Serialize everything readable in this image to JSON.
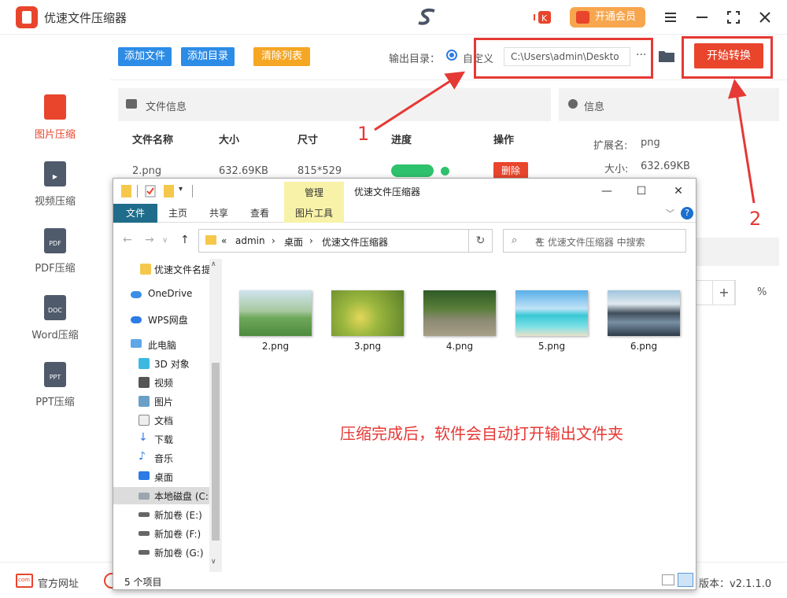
{
  "app": {
    "title": "优速文件压缩器",
    "vip_label": "开通会员",
    "version": "版本：v2.1.1.0",
    "site_link": "官方网址"
  },
  "sidebar": {
    "items": [
      {
        "label": "图片压缩",
        "icon": "image-file-icon",
        "active": true
      },
      {
        "label": "视频压缩",
        "icon": "video-file-icon",
        "active": false
      },
      {
        "label": "PDF压缩",
        "icon": "pdf-file-icon",
        "badge": "PDF",
        "active": false
      },
      {
        "label": "Word压缩",
        "icon": "doc-file-icon",
        "badge": "DOC",
        "active": false
      },
      {
        "label": "PPT压缩",
        "icon": "ppt-file-icon",
        "badge": "PPT",
        "active": false
      }
    ]
  },
  "toolbar": {
    "add_file": "添加文件",
    "add_dir": "添加目录",
    "clear_list": "清除列表",
    "output_label": "输出目录：",
    "radio_label": "自定义",
    "output_path": "C:\\Users\\admin\\Deskto",
    "more": "···",
    "start": "开始转换"
  },
  "file_panel": {
    "title": "文件信息",
    "columns": [
      "文件名称",
      "大小",
      "尺寸",
      "进度",
      "操作"
    ],
    "rows": [
      {
        "name": "2.png",
        "size": "632.69KB",
        "dims": "815*529",
        "progress": 1.0,
        "action": "删除"
      }
    ]
  },
  "info_panel": {
    "title": "信息",
    "ext_label": "扩展名:",
    "ext_value": "png",
    "size_label": "大小:",
    "size_value": "632.69KB",
    "plus": "+",
    "percent": "%"
  },
  "annotations": {
    "num1": "1",
    "num2": "2",
    "color": "#e53935"
  },
  "explorer": {
    "title": "优速文件压缩器",
    "manage_tab": "管理",
    "tabs": [
      "文件",
      "主页",
      "共享",
      "查看",
      "图片工具"
    ],
    "breadcrumb": [
      "«",
      "admin",
      "›",
      "桌面",
      "›",
      "优速文件压缩器"
    ],
    "search_placeholder": "在 优速文件压缩器 中搜索",
    "tree": [
      {
        "label": "优速文件名提",
        "icon": "folder-icon"
      },
      {
        "label": "OneDrive",
        "icon": "cloud-icon"
      },
      {
        "label": "WPS网盘",
        "icon": "wps-cloud-icon"
      },
      {
        "label": "此电脑",
        "icon": "computer-icon"
      },
      {
        "label": "3D 对象",
        "icon": "3d-objects-icon"
      },
      {
        "label": "视频",
        "icon": "video-folder-icon"
      },
      {
        "label": "图片",
        "icon": "pictures-folder-icon"
      },
      {
        "label": "文档",
        "icon": "documents-folder-icon"
      },
      {
        "label": "下载",
        "icon": "download-folder-icon"
      },
      {
        "label": "音乐",
        "icon": "music-folder-icon"
      },
      {
        "label": "桌面",
        "icon": "desktop-folder-icon"
      },
      {
        "label": "本地磁盘 (C:",
        "icon": "drive-c-icon",
        "selected": true
      },
      {
        "label": "新加卷 (E:)",
        "icon": "drive-icon"
      },
      {
        "label": "新加卷 (F:)",
        "icon": "drive-icon"
      },
      {
        "label": "新加卷 (G:)",
        "icon": "drive-icon"
      }
    ],
    "files": [
      "2.png",
      "3.png",
      "4.png",
      "5.png",
      "6.png"
    ],
    "message": "压缩完成后，软件会自动打开输出文件夹",
    "status": "5 个项目"
  },
  "colors": {
    "accent_red": "#e8452c",
    "blue_button": "#2d8ce6",
    "orange_button": "#f5a623",
    "progress_green": "#2dc26b"
  }
}
